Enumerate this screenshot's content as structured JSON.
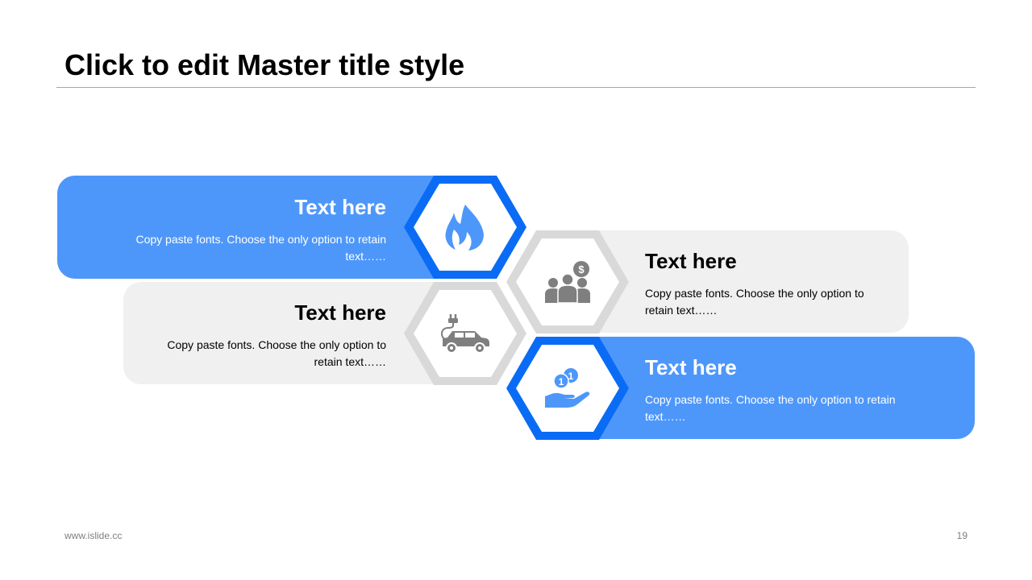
{
  "slide": {
    "title": "Click to edit Master title style"
  },
  "items": [
    {
      "heading": "Text here",
      "body": "Copy paste fonts. Choose the only option to retain text……",
      "icon": "fire-icon"
    },
    {
      "heading": "Text here",
      "body": "Copy paste fonts. Choose the only option to retain text……",
      "icon": "people-money-icon"
    },
    {
      "heading": "Text here",
      "body": "Copy paste fonts. Choose the only option to retain text……",
      "icon": "electric-car-icon"
    },
    {
      "heading": "Text here",
      "body": "Copy paste fonts. Choose the only option to retain text……",
      "icon": "hand-coins-icon"
    }
  ],
  "footer": {
    "url": "www.islide.cc",
    "page_number": "19"
  },
  "colors": {
    "accent_blue": "#0a6cf5",
    "light_blue": "#4e97fa",
    "gray_fill": "#f0f0f0",
    "hex_gray": "#d9d9d9",
    "icon_gray": "#7f7f7f"
  }
}
